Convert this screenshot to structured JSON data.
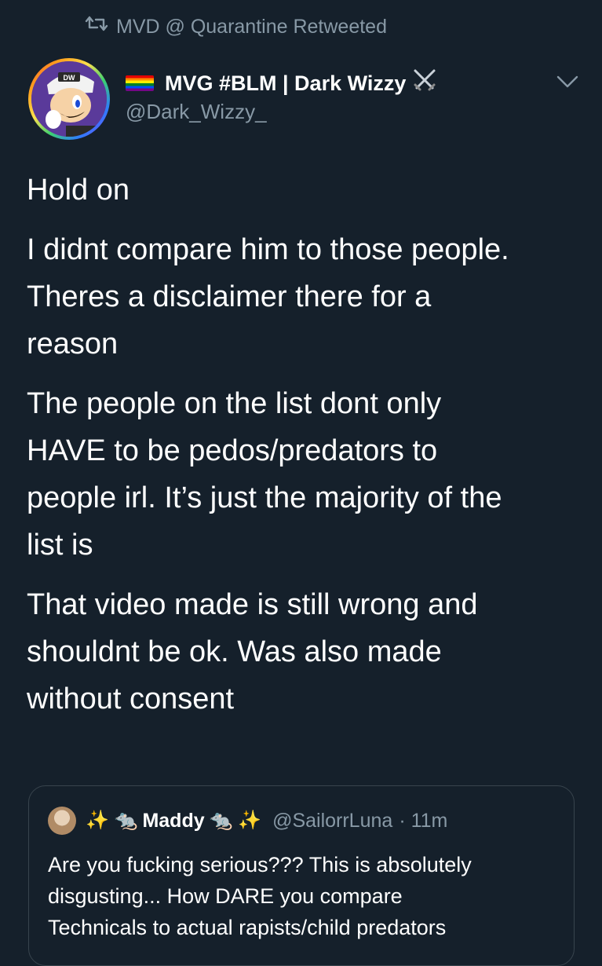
{
  "retweet": {
    "label": "MVD @ Quarantine Retweeted",
    "icon": "retweet-icon"
  },
  "author": {
    "flag_icon": "rainbow-flag-icon",
    "display_name": "MVG #BLM | Dark Wizzy",
    "badge_icon": "crossed-swords-icon",
    "handle": "@Dark_Wizzy_"
  },
  "menu": {
    "icon": "chevron-down-icon"
  },
  "tweet": {
    "paragraphs": [
      "Hold on",
      "I didnt compare him to those people.\nTheres a disclaimer there for a\nreason",
      "The people on the list dont only\nHAVE to be pedos/predators to\npeople irl. It’s just the majority of the\nlist is",
      "That video made is still wrong and\nshouldnt be ok. Was also made\nwithout consent"
    ]
  },
  "quoted": {
    "prefix": "✨ 🐀",
    "name": "Maddy",
    "suffix": "🐀 ✨",
    "handle": "@SailorrLuna",
    "time": "· 11m",
    "text": "Are you fucking serious??? This is absolutely\ndisgusting... How DARE you compare\nTechnicals to actual rapists/child predators"
  },
  "colors": {
    "background": "#15202b",
    "secondary_text": "#8899a6",
    "border": "#38444d"
  }
}
